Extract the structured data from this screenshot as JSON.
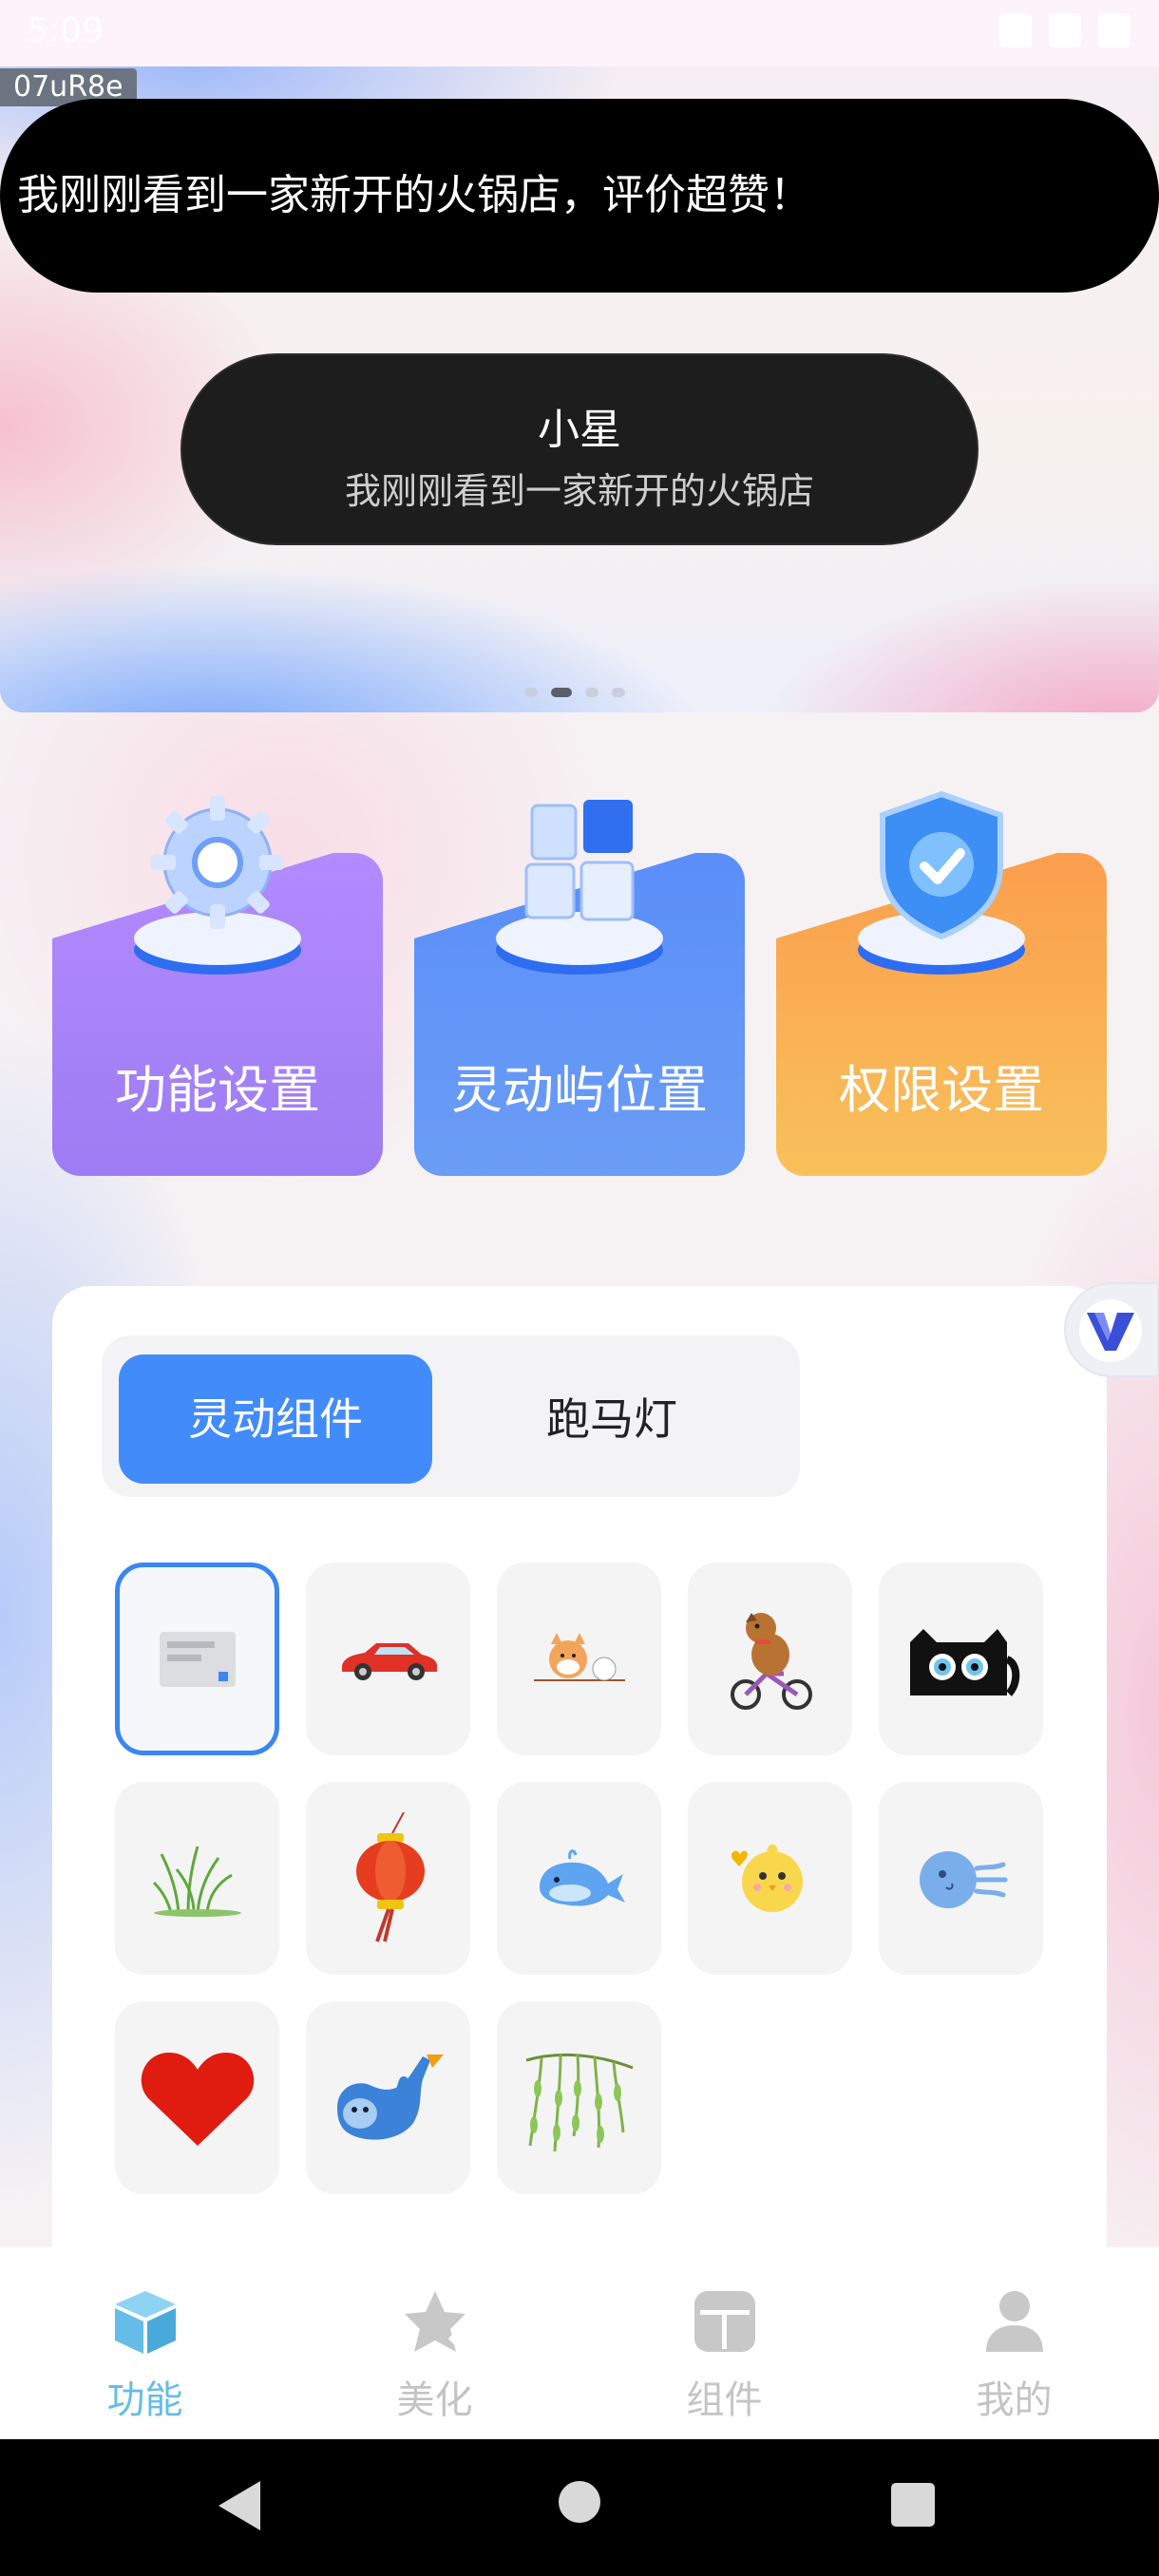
{
  "status_bar": {
    "time": "5:09"
  },
  "debug_tag": "07uR8e",
  "toast": {
    "text": "我刚刚看到一家新开的火锅店，评价超赞！"
  },
  "island_preview": {
    "name": "小星",
    "message": "我刚刚看到一家新开的火锅店"
  },
  "carousel": {
    "page_count": 4,
    "active_index": 1
  },
  "quick_cards": [
    {
      "label": "功能设置",
      "icon": "gear-icon"
    },
    {
      "label": "灵动屿位置",
      "icon": "blocks-icon"
    },
    {
      "label": "权限设置",
      "icon": "shield-check-icon"
    }
  ],
  "widget_tabs": [
    {
      "label": "灵动组件",
      "active": true
    },
    {
      "label": "跑马灯",
      "active": false
    }
  ],
  "widgets": [
    "message-card-icon",
    "red-car-icon",
    "shiba-cat-icon",
    "dog-bicycle-icon",
    "black-cat-icon",
    "grass-icon",
    "red-lantern-icon",
    "whale-icon",
    "yellow-chick-icon",
    "jellyfish-icon",
    "red-heart-icon",
    "sloth-icon",
    "willow-branch-icon"
  ],
  "selected_widget_index": 0,
  "bottom_nav": [
    {
      "label": "功能",
      "icon": "cube-icon",
      "active": true
    },
    {
      "label": "美化",
      "icon": "star-icon",
      "active": false
    },
    {
      "label": "组件",
      "icon": "widget-icon",
      "active": false
    },
    {
      "label": "我的",
      "icon": "person-icon",
      "active": false
    }
  ],
  "colors": {
    "accent": "#428bfb",
    "nav_active": "#65bde7",
    "nav_inactive": "#c4c4c4"
  }
}
